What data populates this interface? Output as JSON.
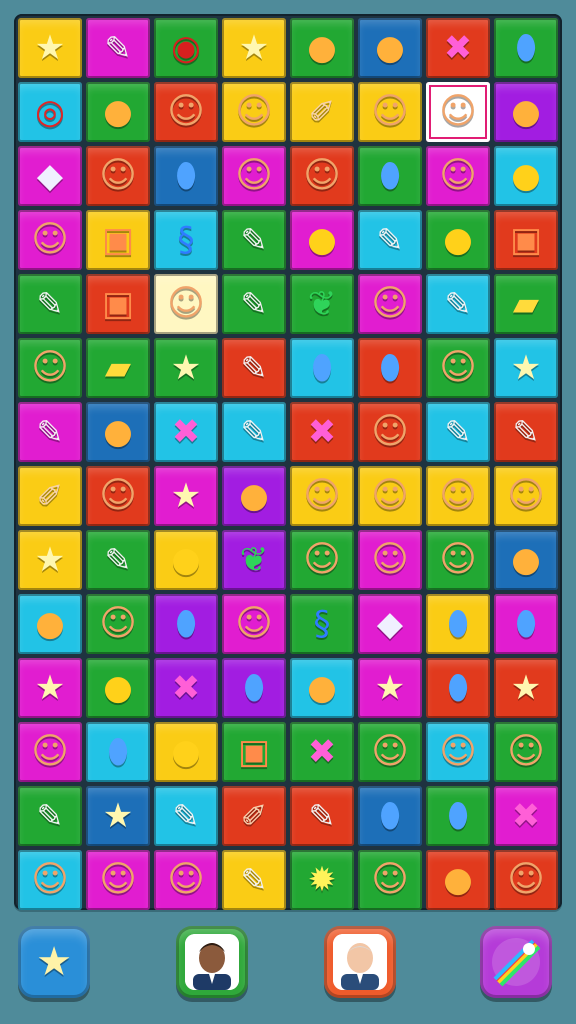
{
  "board": {
    "rows": 14,
    "cols": 8,
    "selected_cell": [
      1,
      6
    ],
    "tiles": [
      [
        [
          "#facc15",
          "star-icon"
        ],
        [
          "#e11dd0",
          "crayon-icon"
        ],
        [
          "#22a833",
          "button-icon"
        ],
        [
          "#facc15",
          "star-icon"
        ],
        [
          "#22a833",
          "blob-icon"
        ],
        [
          "#1d6fb8",
          "blob-icon"
        ],
        [
          "#e13a1d",
          "x-mark-icon"
        ],
        [
          "#22a833",
          "bean-icon"
        ]
      ],
      [
        [
          "#22c3e6",
          "target-icon"
        ],
        [
          "#22a833",
          "blob-icon"
        ],
        [
          "#e13a1d",
          "cat-face-icon"
        ],
        [
          "#facc15",
          "cat-face-icon"
        ],
        [
          "#facc15",
          "pencil-icon"
        ],
        [
          "#facc15",
          "cat-face-icon"
        ],
        [
          "#ffffff",
          "cat-face-icon"
        ],
        [
          "#a21de1",
          "blob-icon"
        ]
      ],
      [
        [
          "#e11dd0",
          "gem-icon"
        ],
        [
          "#e13a1d",
          "cat-face-icon"
        ],
        [
          "#1d6fb8",
          "bean-icon"
        ],
        [
          "#e11dd0",
          "cat-face-icon"
        ],
        [
          "#e13a1d",
          "cat-face-icon"
        ],
        [
          "#22a833",
          "bean-icon"
        ],
        [
          "#e11dd0",
          "cat-face-icon"
        ],
        [
          "#22c3e6",
          "ball-icon"
        ]
      ],
      [
        [
          "#e11dd0",
          "cat-face-icon"
        ],
        [
          "#facc15",
          "box-icon"
        ],
        [
          "#22c3e6",
          "swirl-icon"
        ],
        [
          "#22a833",
          "crayon-icon"
        ],
        [
          "#e11dd0",
          "ball-icon"
        ],
        [
          "#22c3e6",
          "crayon-icon"
        ],
        [
          "#22a833",
          "ball-icon"
        ],
        [
          "#e13a1d",
          "box-icon"
        ]
      ],
      [
        [
          "#22a833",
          "crayon-icon"
        ],
        [
          "#e13a1d",
          "box-icon"
        ],
        [
          "#fff7c2",
          "cat-face-icon"
        ],
        [
          "#22a833",
          "crayon-icon"
        ],
        [
          "#22a833",
          "pepper-icon"
        ],
        [
          "#e11dd0",
          "cat-face-icon"
        ],
        [
          "#22c3e6",
          "crayon-icon"
        ],
        [
          "#22a833",
          "bar-icon"
        ]
      ],
      [
        [
          "#22a833",
          "cat-face-icon"
        ],
        [
          "#22a833",
          "bar-icon"
        ],
        [
          "#22a833",
          "star-icon"
        ],
        [
          "#e13a1d",
          "crayon-icon"
        ],
        [
          "#22c3e6",
          "bean-icon"
        ],
        [
          "#e13a1d",
          "bean-icon"
        ],
        [
          "#22a833",
          "cat-face-icon"
        ],
        [
          "#22c3e6",
          "star-icon"
        ]
      ],
      [
        [
          "#e11dd0",
          "crayon-icon"
        ],
        [
          "#1d6fb8",
          "blob-icon"
        ],
        [
          "#22c3e6",
          "x-mark-icon"
        ],
        [
          "#22c3e6",
          "crayon-icon"
        ],
        [
          "#e13a1d",
          "x-mark-icon"
        ],
        [
          "#e13a1d",
          "cat-face-icon"
        ],
        [
          "#22c3e6",
          "crayon-icon"
        ],
        [
          "#e13a1d",
          "crayon-icon"
        ]
      ],
      [
        [
          "#facc15",
          "pencil-icon"
        ],
        [
          "#e13a1d",
          "cat-face-icon"
        ],
        [
          "#e11dd0",
          "star-icon"
        ],
        [
          "#a21de1",
          "blob-icon"
        ],
        [
          "#facc15",
          "cat-face-icon"
        ],
        [
          "#facc15",
          "cat-face-icon"
        ],
        [
          "#facc15",
          "cat-face-icon"
        ],
        [
          "#facc15",
          "cat-face-icon"
        ]
      ],
      [
        [
          "#facc15",
          "star-icon"
        ],
        [
          "#22a833",
          "crayon-icon"
        ],
        [
          "#facc15",
          "ball-icon"
        ],
        [
          "#a21de1",
          "pepper-icon"
        ],
        [
          "#22a833",
          "cat-face-icon"
        ],
        [
          "#e11dd0",
          "cat-face-icon"
        ],
        [
          "#22a833",
          "cat-face-icon"
        ],
        [
          "#1d6fb8",
          "blob-icon"
        ]
      ],
      [
        [
          "#22c3e6",
          "blob-icon"
        ],
        [
          "#22a833",
          "cat-face-icon"
        ],
        [
          "#a21de1",
          "bean-icon"
        ],
        [
          "#e11dd0",
          "cat-face-icon"
        ],
        [
          "#22a833",
          "swirl-icon"
        ],
        [
          "#e11dd0",
          "gem-icon"
        ],
        [
          "#facc15",
          "bean-icon"
        ],
        [
          "#e11dd0",
          "bean-icon"
        ]
      ],
      [
        [
          "#e11dd0",
          "star-icon"
        ],
        [
          "#22a833",
          "ball-icon"
        ],
        [
          "#a21de1",
          "x-mark-icon"
        ],
        [
          "#a21de1",
          "bean-icon"
        ],
        [
          "#22c3e6",
          "blob-icon"
        ],
        [
          "#e11dd0",
          "star-icon"
        ],
        [
          "#e13a1d",
          "bean-icon"
        ],
        [
          "#e13a1d",
          "star-icon"
        ]
      ],
      [
        [
          "#e11dd0",
          "cat-face-icon"
        ],
        [
          "#22c3e6",
          "bean-icon"
        ],
        [
          "#facc15",
          "ball-icon"
        ],
        [
          "#22a833",
          "box-icon"
        ],
        [
          "#22a833",
          "x-mark-icon"
        ],
        [
          "#22a833",
          "cat-face-icon"
        ],
        [
          "#22c3e6",
          "cat-face-icon"
        ],
        [
          "#22a833",
          "cat-face-icon"
        ]
      ],
      [
        [
          "#22a833",
          "crayon-icon"
        ],
        [
          "#1d6fb8",
          "star-icon"
        ],
        [
          "#22c3e6",
          "crayon-icon"
        ],
        [
          "#e13a1d",
          "pencil-icon"
        ],
        [
          "#e13a1d",
          "crayon-icon"
        ],
        [
          "#1d6fb8",
          "bean-icon"
        ],
        [
          "#22a833",
          "bean-icon"
        ],
        [
          "#e11dd0",
          "x-mark-icon"
        ]
      ],
      [
        [
          "#22c3e6",
          "cat-face-icon"
        ],
        [
          "#e11dd0",
          "cat-face-icon"
        ],
        [
          "#e11dd0",
          "cat-face-icon"
        ],
        [
          "#facc15",
          "crayon-icon"
        ],
        [
          "#22a833",
          "sunburst-icon"
        ],
        [
          "#22a833",
          "cat-face-icon"
        ],
        [
          "#e13a1d",
          "blob-icon"
        ],
        [
          "#e13a1d",
          "cat-face-icon"
        ]
      ]
    ]
  },
  "footer": {
    "buttons": [
      {
        "name": "star-booster-button",
        "icon": "star-icon",
        "color": "#2a8fd8"
      },
      {
        "name": "character-portrait-button-1",
        "icon": "portrait-man-icon",
        "color": "#2fa83a"
      },
      {
        "name": "character-portrait-button-2",
        "icon": "portrait-man-icon",
        "color": "#ef5b2b"
      },
      {
        "name": "rainbow-blast-button",
        "icon": "rainbow-burst-icon",
        "color": "#b53bd8"
      }
    ]
  }
}
